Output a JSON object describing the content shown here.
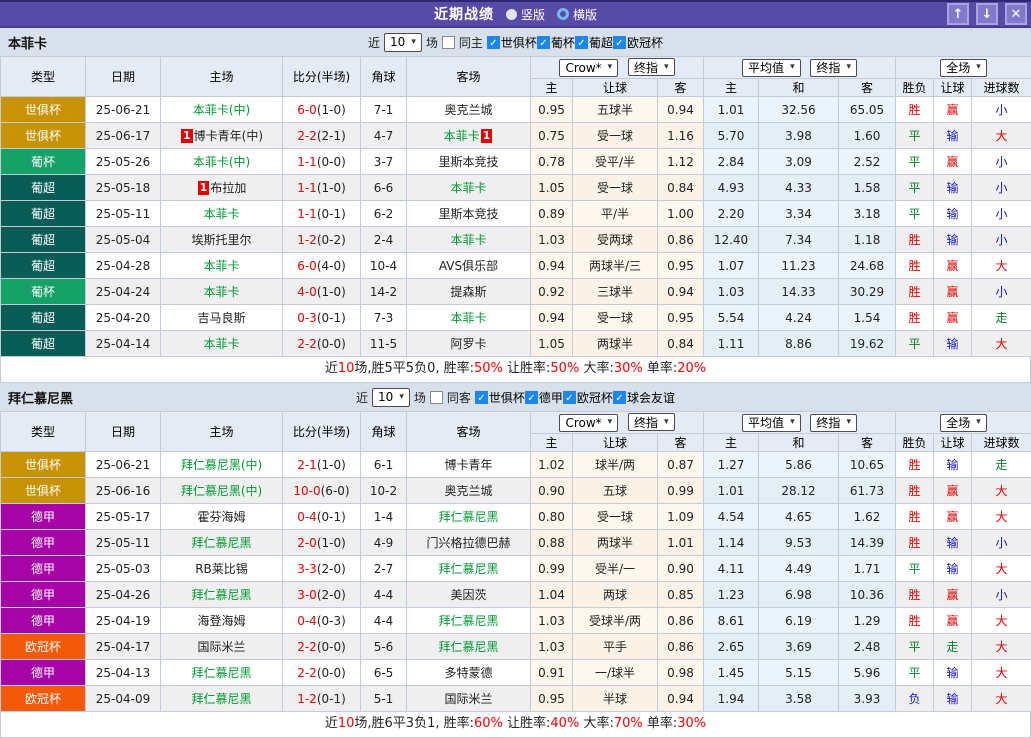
{
  "icons": {
    "chevron": "▾",
    "check": "✓",
    "up": "↑",
    "down": "↓",
    "close": "✕"
  },
  "titlebar": {
    "title": "近期战绩",
    "radio_vertical": "竖版",
    "radio_horizontal": "横版"
  },
  "type_colors": {
    "世俱杯": "#C79305",
    "葡杯": "#16A169",
    "葡超": "#0A5C57",
    "德甲": "#A704A7",
    "欧冠杯": "#F2590B"
  },
  "result_colors": {
    "胜": "#E60000",
    "平": "#008026",
    "负": "#1515CD",
    "赢": "#E60000",
    "输": "#1515CD",
    "走": "#008026",
    "大": "#E60000",
    "小": "#1515CD"
  },
  "team_green": "#009933",
  "sections": [
    {
      "team": "本菲卡",
      "filter": {
        "prefix": "近",
        "count": "10",
        "suffix": "场",
        "same_label": "同主",
        "same_checked": false,
        "competitions": [
          "世俱杯",
          "葡杯",
          "葡超",
          "欧冠杯"
        ]
      },
      "selects": {
        "bookmaker": "Crow*",
        "odds_time1": "终指",
        "average": "平均值",
        "odds_time2": "终指",
        "scope": "全场"
      },
      "columns": {
        "type": "类型",
        "date": "日期",
        "home": "主场",
        "score": "比分(半场)",
        "corner": "角球",
        "away": "客场",
        "h": "主",
        "handicap": "让球",
        "a": "客",
        "avg_h": "主",
        "avg_d": "和",
        "avg_a": "客",
        "result": "胜负",
        "handicap_result": "让球",
        "goals": "进球数"
      },
      "rows": [
        {
          "comp": "世俱杯",
          "date": "25-06-21",
          "home": "本菲卡(中)",
          "home_green": true,
          "home_rank": "",
          "score": "6-0",
          "half": "(1-0)",
          "corner": "7-1",
          "away": "奥克兰城",
          "away_green": false,
          "away_rank": "",
          "crow_h": "0.95",
          "line": "五球半",
          "crow_a": "0.94",
          "avg_h": "1.01",
          "avg_d": "32.56",
          "avg_a": "65.05",
          "wdl": "胜",
          "handicap_r": "赢",
          "goals_r": "小"
        },
        {
          "comp": "世俱杯",
          "date": "25-06-17",
          "home": "博卡青年(中)",
          "home_green": false,
          "home_rank": "1",
          "score": "2-2",
          "half": "(2-1)",
          "corner": "4-7",
          "away": "本菲卡",
          "away_green": true,
          "away_rank": "1",
          "crow_h": "0.75",
          "line": "受一球",
          "crow_a": "1.16",
          "avg_h": "5.70",
          "avg_d": "3.98",
          "avg_a": "1.60",
          "wdl": "平",
          "handicap_r": "输",
          "goals_r": "大"
        },
        {
          "comp": "葡杯",
          "date": "25-05-26",
          "home": "本菲卡(中)",
          "home_green": true,
          "home_rank": "",
          "score": "1-1",
          "half": "(0-0)",
          "corner": "3-7",
          "away": "里斯本竞技",
          "away_green": false,
          "away_rank": "",
          "crow_h": "0.78",
          "line": "受平/半",
          "crow_a": "1.12",
          "avg_h": "2.84",
          "avg_d": "3.09",
          "avg_a": "2.52",
          "wdl": "平",
          "handicap_r": "赢",
          "goals_r": "小"
        },
        {
          "comp": "葡超",
          "date": "25-05-18",
          "home": "布拉加",
          "home_green": false,
          "home_rank": "1",
          "score": "1-1",
          "half": "(1-0)",
          "corner": "6-6",
          "away": "本菲卡",
          "away_green": true,
          "away_rank": "",
          "crow_h": "1.05",
          "line": "受一球",
          "crow_a": "0.84",
          "avg_h": "4.93",
          "avg_d": "4.33",
          "avg_a": "1.58",
          "wdl": "平",
          "handicap_r": "输",
          "goals_r": "小"
        },
        {
          "comp": "葡超",
          "date": "25-05-11",
          "home": "本菲卡",
          "home_green": true,
          "home_rank": "",
          "score": "1-1",
          "half": "(0-1)",
          "corner": "6-2",
          "away": "里斯本竞技",
          "away_green": false,
          "away_rank": "",
          "crow_h": "0.89",
          "line": "平/半",
          "crow_a": "1.00",
          "avg_h": "2.20",
          "avg_d": "3.34",
          "avg_a": "3.18",
          "wdl": "平",
          "handicap_r": "输",
          "goals_r": "小"
        },
        {
          "comp": "葡超",
          "date": "25-05-04",
          "home": "埃斯托里尔",
          "home_green": false,
          "home_rank": "",
          "score": "1-2",
          "half": "(0-2)",
          "corner": "2-4",
          "away": "本菲卡",
          "away_green": true,
          "away_rank": "",
          "crow_h": "1.03",
          "line": "受两球",
          "crow_a": "0.86",
          "avg_h": "12.40",
          "avg_d": "7.34",
          "avg_a": "1.18",
          "wdl": "胜",
          "handicap_r": "输",
          "goals_r": "小"
        },
        {
          "comp": "葡超",
          "date": "25-04-28",
          "home": "本菲卡",
          "home_green": true,
          "home_rank": "",
          "score": "6-0",
          "half": "(4-0)",
          "corner": "10-4",
          "away": "AVS俱乐部",
          "away_green": false,
          "away_rank": "",
          "crow_h": "0.94",
          "line": "两球半/三",
          "crow_a": "0.95",
          "avg_h": "1.07",
          "avg_d": "11.23",
          "avg_a": "24.68",
          "wdl": "胜",
          "handicap_r": "赢",
          "goals_r": "大"
        },
        {
          "comp": "葡杯",
          "date": "25-04-24",
          "home": "本菲卡",
          "home_green": true,
          "home_rank": "",
          "score": "4-0",
          "half": "(1-0)",
          "corner": "14-2",
          "away": "提森斯",
          "away_green": false,
          "away_rank": "",
          "crow_h": "0.92",
          "line": "三球半",
          "crow_a": "0.94",
          "avg_h": "1.03",
          "avg_d": "14.33",
          "avg_a": "30.29",
          "wdl": "胜",
          "handicap_r": "赢",
          "goals_r": "小"
        },
        {
          "comp": "葡超",
          "date": "25-04-20",
          "home": "吉马良斯",
          "home_green": false,
          "home_rank": "",
          "score": "0-3",
          "half": "(0-1)",
          "corner": "7-3",
          "away": "本菲卡",
          "away_green": true,
          "away_rank": "",
          "crow_h": "0.94",
          "line": "受一球",
          "crow_a": "0.95",
          "avg_h": "5.54",
          "avg_d": "4.24",
          "avg_a": "1.54",
          "wdl": "胜",
          "handicap_r": "赢",
          "goals_r": "走"
        },
        {
          "comp": "葡超",
          "date": "25-04-14",
          "home": "本菲卡",
          "home_green": true,
          "home_rank": "",
          "score": "2-2",
          "half": "(0-0)",
          "corner": "11-5",
          "away": "阿罗卡",
          "away_green": false,
          "away_rank": "",
          "crow_h": "1.05",
          "line": "两球半",
          "crow_a": "0.84",
          "avg_h": "1.11",
          "avg_d": "8.86",
          "avg_a": "19.62",
          "wdl": "平",
          "handicap_r": "输",
          "goals_r": "大"
        }
      ],
      "summary": [
        {
          "t": "近"
        },
        {
          "t": "10",
          "red": true
        },
        {
          "t": "场,胜5平5负0, 胜率:"
        },
        {
          "t": "50%",
          "red": true
        },
        {
          "t": " 让胜率:"
        },
        {
          "t": "50%",
          "red": true
        },
        {
          "t": " 大率:"
        },
        {
          "t": "30%",
          "red": true
        },
        {
          "t": " 单率:"
        },
        {
          "t": "20%",
          "red": true
        }
      ]
    },
    {
      "team": "拜仁慕尼黑",
      "filter": {
        "prefix": "近",
        "count": "10",
        "suffix": "场",
        "same_label": "同客",
        "same_checked": false,
        "competitions": [
          "世俱杯",
          "德甲",
          "欧冠杯",
          "球会友谊"
        ]
      },
      "selects": {
        "bookmaker": "Crow*",
        "odds_time1": "终指",
        "average": "平均值",
        "odds_time2": "终指",
        "scope": "全场"
      },
      "columns": {
        "type": "类型",
        "date": "日期",
        "home": "主场",
        "score": "比分(半场)",
        "corner": "角球",
        "away": "客场",
        "h": "主",
        "handicap": "让球",
        "a": "客",
        "avg_h": "主",
        "avg_d": "和",
        "avg_a": "客",
        "result": "胜负",
        "handicap_result": "让球",
        "goals": "进球数"
      },
      "rows": [
        {
          "comp": "世俱杯",
          "date": "25-06-21",
          "home": "拜仁慕尼黑(中)",
          "home_green": true,
          "home_rank": "",
          "score": "2-1",
          "half": "(1-0)",
          "corner": "6-1",
          "away": "博卡青年",
          "away_green": false,
          "away_rank": "",
          "crow_h": "1.02",
          "line": "球半/两",
          "crow_a": "0.87",
          "avg_h": "1.27",
          "avg_d": "5.86",
          "avg_a": "10.65",
          "wdl": "胜",
          "handicap_r": "输",
          "goals_r": "走"
        },
        {
          "comp": "世俱杯",
          "date": "25-06-16",
          "home": "拜仁慕尼黑(中)",
          "home_green": true,
          "home_rank": "",
          "score": "10-0",
          "half": "(6-0)",
          "corner": "10-2",
          "away": "奥克兰城",
          "away_green": false,
          "away_rank": "",
          "crow_h": "0.90",
          "line": "五球",
          "crow_a": "0.99",
          "avg_h": "1.01",
          "avg_d": "28.12",
          "avg_a": "61.73",
          "wdl": "胜",
          "handicap_r": "赢",
          "goals_r": "大"
        },
        {
          "comp": "德甲",
          "date": "25-05-17",
          "home": "霍芬海姆",
          "home_green": false,
          "home_rank": "",
          "score": "0-4",
          "half": "(0-1)",
          "corner": "1-4",
          "away": "拜仁慕尼黑",
          "away_green": true,
          "away_rank": "",
          "crow_h": "0.80",
          "line": "受一球",
          "crow_a": "1.09",
          "avg_h": "4.54",
          "avg_d": "4.65",
          "avg_a": "1.62",
          "wdl": "胜",
          "handicap_r": "赢",
          "goals_r": "大"
        },
        {
          "comp": "德甲",
          "date": "25-05-11",
          "home": "拜仁慕尼黑",
          "home_green": true,
          "home_rank": "",
          "score": "2-0",
          "half": "(1-0)",
          "corner": "4-9",
          "away": "门兴格拉德巴赫",
          "away_green": false,
          "away_rank": "",
          "crow_h": "0.88",
          "line": "两球半",
          "crow_a": "1.01",
          "avg_h": "1.14",
          "avg_d": "9.53",
          "avg_a": "14.39",
          "wdl": "胜",
          "handicap_r": "输",
          "goals_r": "小"
        },
        {
          "comp": "德甲",
          "date": "25-05-03",
          "home": "RB莱比锡",
          "home_green": false,
          "home_rank": "",
          "score": "3-3",
          "half": "(2-0)",
          "corner": "2-7",
          "away": "拜仁慕尼黑",
          "away_green": true,
          "away_rank": "",
          "crow_h": "0.99",
          "line": "受半/一",
          "crow_a": "0.90",
          "avg_h": "4.11",
          "avg_d": "4.49",
          "avg_a": "1.71",
          "wdl": "平",
          "handicap_r": "输",
          "goals_r": "大"
        },
        {
          "comp": "德甲",
          "date": "25-04-26",
          "home": "拜仁慕尼黑",
          "home_green": true,
          "home_rank": "",
          "score": "3-0",
          "half": "(2-0)",
          "corner": "4-4",
          "away": "美因茨",
          "away_green": false,
          "away_rank": "",
          "crow_h": "1.04",
          "line": "两球",
          "crow_a": "0.85",
          "avg_h": "1.23",
          "avg_d": "6.98",
          "avg_a": "10.36",
          "wdl": "胜",
          "handicap_r": "赢",
          "goals_r": "小"
        },
        {
          "comp": "德甲",
          "date": "25-04-19",
          "home": "海登海姆",
          "home_green": false,
          "home_rank": "",
          "score": "0-4",
          "half": "(0-3)",
          "corner": "4-4",
          "away": "拜仁慕尼黑",
          "away_green": true,
          "away_rank": "",
          "crow_h": "1.03",
          "line": "受球半/两",
          "crow_a": "0.86",
          "avg_h": "8.61",
          "avg_d": "6.19",
          "avg_a": "1.29",
          "wdl": "胜",
          "handicap_r": "赢",
          "goals_r": "大"
        },
        {
          "comp": "欧冠杯",
          "date": "25-04-17",
          "home": "国际米兰",
          "home_green": false,
          "home_rank": "",
          "score": "2-2",
          "half": "(0-0)",
          "corner": "5-6",
          "away": "拜仁慕尼黑",
          "away_green": true,
          "away_rank": "",
          "crow_h": "1.03",
          "line": "平手",
          "crow_a": "0.86",
          "avg_h": "2.65",
          "avg_d": "3.69",
          "avg_a": "2.48",
          "wdl": "平",
          "handicap_r": "走",
          "goals_r": "大"
        },
        {
          "comp": "德甲",
          "date": "25-04-13",
          "home": "拜仁慕尼黑",
          "home_green": true,
          "home_rank": "",
          "score": "2-2",
          "half": "(0-0)",
          "corner": "6-5",
          "away": "多特蒙德",
          "away_green": false,
          "away_rank": "",
          "crow_h": "0.91",
          "line": "一/球半",
          "crow_a": "0.98",
          "avg_h": "1.45",
          "avg_d": "5.15",
          "avg_a": "5.96",
          "wdl": "平",
          "handicap_r": "输",
          "goals_r": "大"
        },
        {
          "comp": "欧冠杯",
          "date": "25-04-09",
          "home": "拜仁慕尼黑",
          "home_green": true,
          "home_rank": "",
          "score": "1-2",
          "half": "(0-1)",
          "corner": "5-1",
          "away": "国际米兰",
          "away_green": false,
          "away_rank": "",
          "crow_h": "0.95",
          "line": "半球",
          "crow_a": "0.94",
          "avg_h": "1.94",
          "avg_d": "3.58",
          "avg_a": "3.93",
          "wdl": "负",
          "handicap_r": "输",
          "goals_r": "大"
        }
      ],
      "summary": [
        {
          "t": "近"
        },
        {
          "t": "10",
          "red": true
        },
        {
          "t": "场,胜6平3负1, 胜率:"
        },
        {
          "t": "60%",
          "red": true
        },
        {
          "t": " 让胜率:"
        },
        {
          "t": "40%",
          "red": true
        },
        {
          "t": " 大率:"
        },
        {
          "t": "70%",
          "red": true
        },
        {
          "t": " 单率:"
        },
        {
          "t": "30%",
          "red": true
        }
      ]
    }
  ]
}
